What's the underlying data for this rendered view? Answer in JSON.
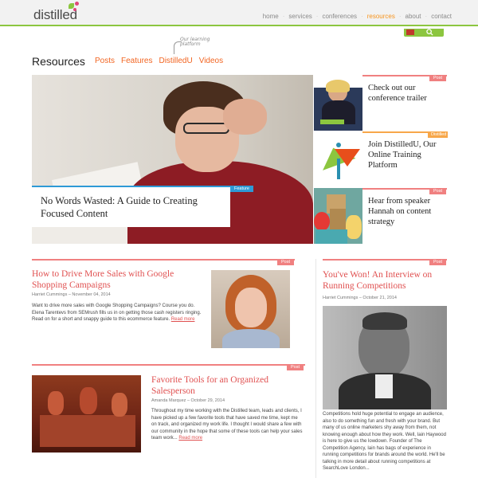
{
  "header": {
    "logo_text": "distilled",
    "nav": [
      "home",
      "services",
      "conferences",
      "resources",
      "about",
      "contact"
    ],
    "nav_active": "resources",
    "accent_green": "#8cc63f",
    "accent_orange": "#f7941d"
  },
  "section": {
    "title": "Resources",
    "subnav": [
      "Posts",
      "Features",
      "DistilledU",
      "Videos"
    ],
    "annotation": "Our learning platform"
  },
  "hero": {
    "title": "No Words Wasted: A Guide to Creating Focused Content",
    "badge": "Feature"
  },
  "side_cards": [
    {
      "title": "Check out our conference trailer",
      "badge": "Post"
    },
    {
      "title": "Join DistilledU, Our Online Training Platform",
      "badge": "Distilled"
    },
    {
      "title": "Hear from speaker Hannah on content strategy",
      "badge": "Post"
    }
  ],
  "articles": [
    {
      "title": "How to Drive More Sales with Google Shopping Campaigns",
      "badge": "Post",
      "meta": "Harriet Cummings – November 04, 2014",
      "body": "Want to drive more sales with Google Shopping Campaigns? Course you do. Elena Tarentevs from SEMrush fills us in on getting those cash registers ringing. Read on for a short and snappy guide to this ecommerce feature.",
      "read_more": "Read more"
    },
    {
      "title": "Favorite Tools for an Organized Salesperson",
      "badge": "Post",
      "meta": "Amanda Marquez – October 29, 2014",
      "body": "Throughout my time working with the Distilled team, leads and clients, I have picked up a few favorite tools that have saved me time, kept me on track, and organized my work life. I thought I would share a few with our community in the hope that some of these tools can help your sales team work...",
      "read_more": "Read more"
    },
    {
      "title": "You've Won! An Interview on Running Competitions",
      "badge": "Post",
      "meta": "Harriet Cummings – October 21, 2014",
      "body": "Competitions hold huge potential to engage an audience, also to do something fun and fresh with your brand. But many of us online marketers shy away from them, not knowing enough about how they work. Well, Iain Haywood is here to give us the lowdown. Founder of The Competition Agency, Iain has bags of experience in running competitions for brands around the world. He'll be talking in more detail about running competitions at SearchLove London..."
    }
  ]
}
